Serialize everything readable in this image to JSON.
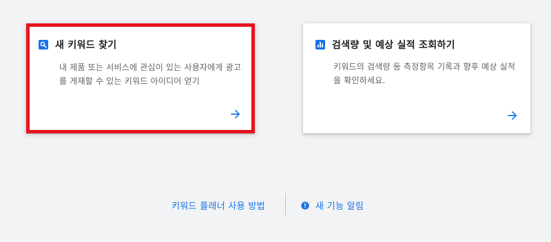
{
  "cards": [
    {
      "title": "새 키워드 찾기",
      "description_line1": "내 제품 또는 서비스에 관심이 있는 사용자에게 광고",
      "description_line2": "를 게재할 수 있는 키워드 아이디어 얻기",
      "icon": "search-icon",
      "action_icon": "arrow-right-icon",
      "highlight_color": "#e8131f"
    },
    {
      "title": "검색량 및 예상 실적 조회하기",
      "description_line1": "키워드의 검색량 등 측정항목 기록과 향후 예상 실적",
      "description_line2": "을 확인하세요.",
      "icon": "bar-chart-icon",
      "action_icon": "arrow-right-icon"
    }
  ],
  "footer": {
    "how_to_label": "키워드 플래너 사용 방법",
    "new_features_label": "새 기능 알림",
    "new_features_icon": "badge-icon"
  },
  "colors": {
    "accent": "#1a73e8",
    "background": "#f1f3f4",
    "card": "#ffffff",
    "highlight": "#e8131f"
  }
}
